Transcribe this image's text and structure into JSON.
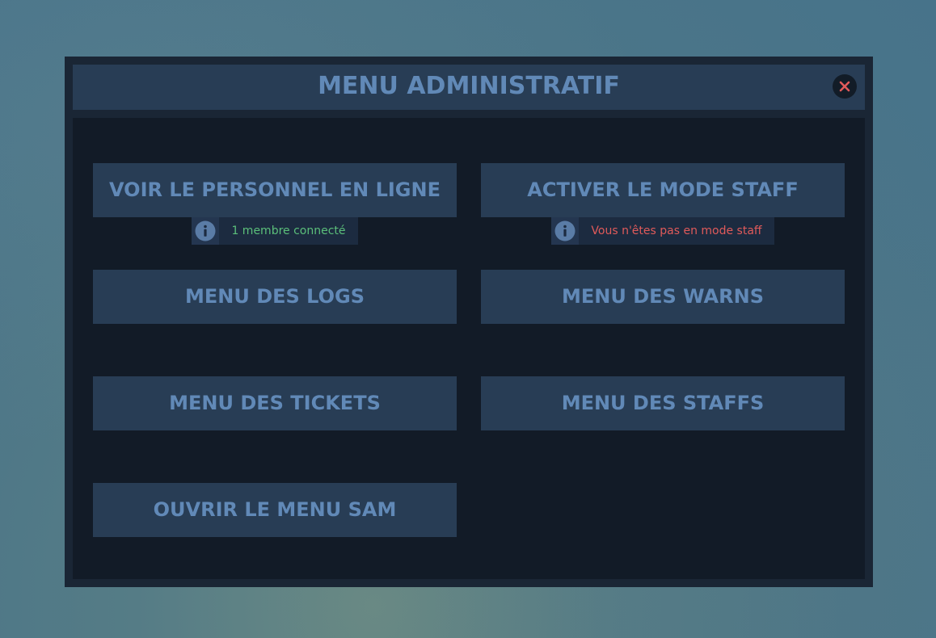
{
  "window": {
    "title": "MENU ADMINISTRATIF",
    "close_icon": "close-icon",
    "close_color": "#e05a5a"
  },
  "buttons": {
    "online_staff": "VOIR LE PERSONNEL EN LIGNE",
    "staff_mode": "ACTIVER LE MODE STAFF",
    "logs": "MENU DES LOGS",
    "warns": "MENU DES WARNS",
    "tickets": "MENU DES TICKETS",
    "staffs": "MENU DES STAFFS",
    "sam": "OUVRIR LE MENU SAM"
  },
  "info": {
    "online_count": {
      "icon": "info-icon",
      "text": "1 membre connecté",
      "color": "#5bbf7a"
    },
    "staff_mode_status": {
      "icon": "info-icon",
      "text": "Vous n'êtes pas en mode staff",
      "color": "#e05a5a"
    }
  },
  "colors": {
    "panel": "#1a2635",
    "button": "#283d55",
    "accent_text": "#6189b7",
    "content_bg": "#121b27"
  }
}
